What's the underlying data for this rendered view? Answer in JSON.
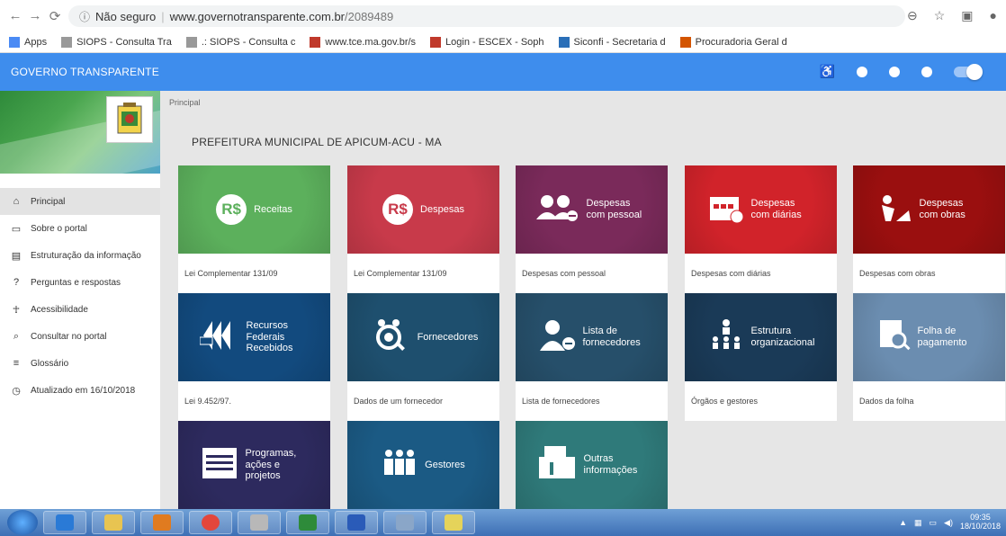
{
  "browser": {
    "security": "Não seguro",
    "host": "www.governotransparente.com.br",
    "path": "/2089489",
    "bookmarks": [
      {
        "label": "Apps",
        "icon": "apps-grid-icon"
      },
      {
        "label": "SIOPS - Consulta Tra",
        "icon": "page-icon"
      },
      {
        "label": ".: SIOPS - Consulta c",
        "icon": "page-icon"
      },
      {
        "label": "www.tce.ma.gov.br/s",
        "icon": "tce-icon"
      },
      {
        "label": "Login - ESCEX - Soph",
        "icon": "book-icon"
      },
      {
        "label": "Siconfi - Secretaria d",
        "icon": "siconfi-icon"
      },
      {
        "label": "Procuradoria Geral d",
        "icon": "procuradoria-icon"
      }
    ]
  },
  "header": {
    "title": "GOVERNO TRANSPARENTE"
  },
  "sidebar": {
    "items": [
      {
        "label": "Principal",
        "icon": "home-icon"
      },
      {
        "label": "Sobre o portal",
        "icon": "folder-icon"
      },
      {
        "label": "Estruturação da informação",
        "icon": "structure-icon"
      },
      {
        "label": "Perguntas e respostas",
        "icon": "question-icon"
      },
      {
        "label": "Acessibilidade",
        "icon": "accessibility-icon"
      },
      {
        "label": "Consultar no portal",
        "icon": "search-icon"
      },
      {
        "label": "Glossário",
        "icon": "list-icon"
      },
      {
        "label": "Atualizado em 16/10/2018",
        "icon": "history-icon"
      }
    ]
  },
  "main": {
    "breadcrumb": "Principal",
    "page_title": "PREFEITURA MUNICIPAL DE APICUM-ACU - MA",
    "tiles": [
      {
        "title": "Receitas",
        "footer": "Lei Complementar 131/09",
        "color": "#5cb05c",
        "icon": "rs-up-icon"
      },
      {
        "title": "Despesas",
        "footer": "Lei Complementar 131/09",
        "color": "#c83a4a",
        "icon": "rs-down-icon"
      },
      {
        "title": "Despesas com pessoal",
        "footer": "Despesas com pessoal",
        "color": "#7a2a5a",
        "icon": "people-minus-icon"
      },
      {
        "title": "Despesas com diárias",
        "footer": "Despesas com diárias",
        "color": "#d1232a",
        "icon": "calendar-rs-icon"
      },
      {
        "title": "Despesas com obras",
        "footer": "Despesas com obras",
        "color": "#9a0f0f",
        "icon": "worker-icon"
      },
      {
        "title": "Recursos Federais Recebidos",
        "footer": "Lei 9.452/97.",
        "color": "#124a7e",
        "icon": "federal-icon"
      },
      {
        "title": "Fornecedores",
        "footer": "Dados de um fornecedor",
        "color": "#1e4f6e",
        "icon": "supplier-search-icon"
      },
      {
        "title": "Lista de fornecedores",
        "footer": "Lista de fornecedores",
        "color": "#264f6a",
        "icon": "person-minus-icon"
      },
      {
        "title": "Estrutura organizacional",
        "footer": "Órgãos e gestores",
        "color": "#1a3a57",
        "icon": "org-icon"
      },
      {
        "title": "Folha de pagamento",
        "footer": "Dados da folha",
        "color": "#6b8db0",
        "icon": "payroll-icon"
      },
      {
        "title": "Programas, ações e projetos",
        "footer": "",
        "color": "#2d2a5e",
        "icon": "program-icon"
      },
      {
        "title": "Gestores",
        "footer": "",
        "color": "#1b5a84",
        "icon": "managers-icon"
      },
      {
        "title": "Outras informações",
        "footer": "",
        "color": "#2f7a7a",
        "icon": "other-info-icon"
      }
    ]
  },
  "taskbar": {
    "time": "09:35",
    "date": "18/10/2018"
  }
}
